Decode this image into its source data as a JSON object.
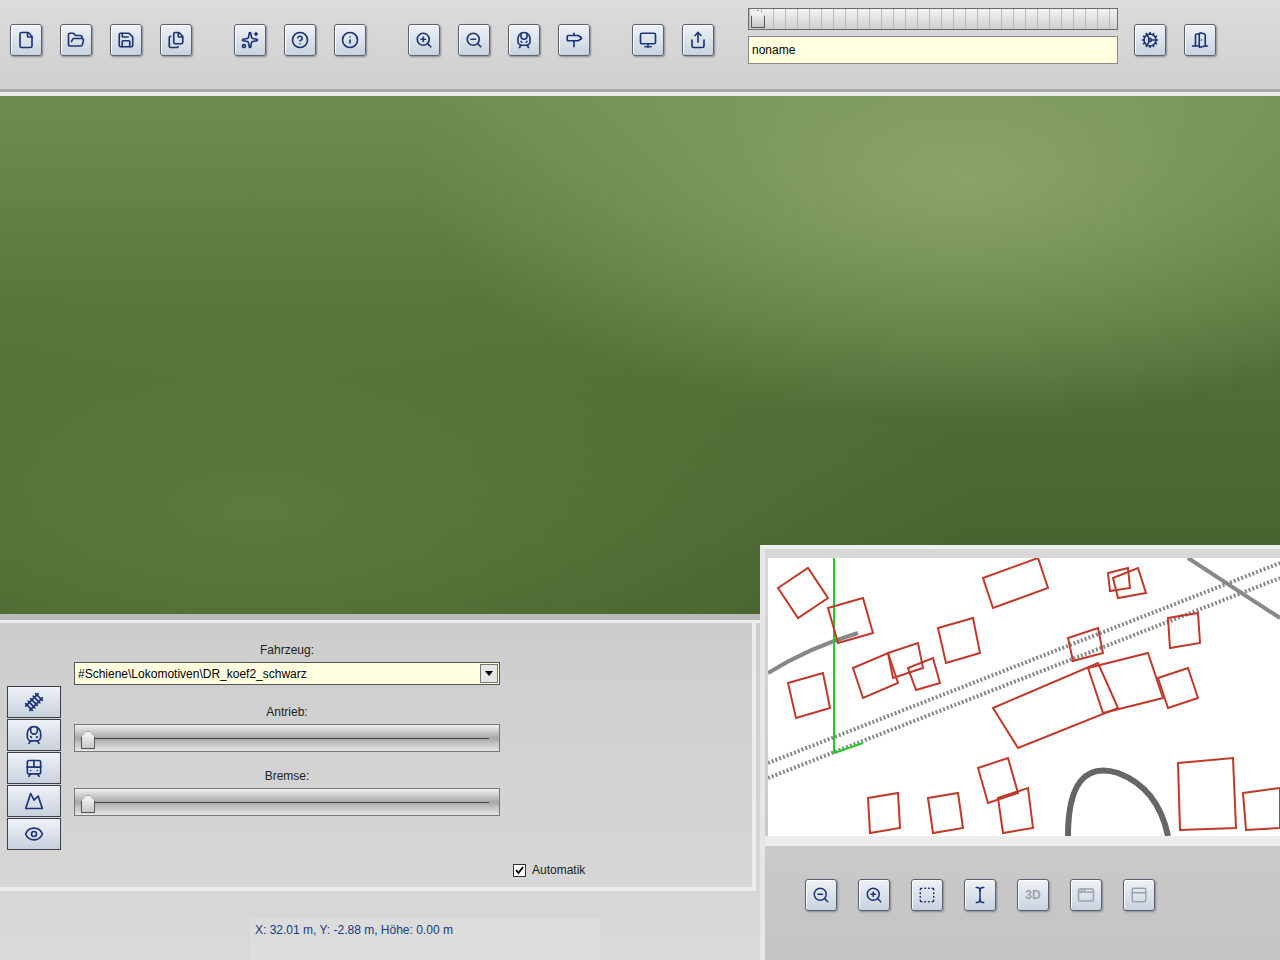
{
  "toolbar": {
    "groups": [
      [
        {
          "disabled": false
        },
        {
          "disabled": false
        },
        {
          "disabled": false
        },
        {
          "disabled": false
        }
      ],
      [
        {
          "disabled": false
        },
        {
          "disabled": false
        },
        {
          "disabled": false
        }
      ],
      [
        {
          "disabled": false
        },
        {
          "disabled": false
        },
        {
          "disabled": false
        },
        {
          "disabled": false
        }
      ],
      [
        {
          "disabled": false
        },
        {
          "disabled": false
        }
      ]
    ],
    "slider": {
      "level": 0.0
    },
    "file_name": "noname",
    "right_buttons": [
      {
        "disabled": false
      },
      {
        "disabled": false
      }
    ]
  },
  "vehicle_panel": {
    "label": "Fahrzeug:",
    "value": "#Schiene\\Lokomotiven\\DR_koef2_schwarz",
    "side_buttons": [
      {
        "selected": false
      },
      {
        "selected": false
      },
      {
        "selected": false
      },
      {
        "selected": false
      },
      {
        "selected": false
      }
    ],
    "sliders": [
      {
        "label": "Antrieb:",
        "level": 0.0
      },
      {
        "label": "Bremse:",
        "level": 0.0
      }
    ],
    "checkbox": {
      "label": "Automatik",
      "checked": true
    }
  },
  "map_panel": {
    "buttons": [
      {
        "label": "",
        "disabled": false
      },
      {
        "label": "",
        "disabled": false
      },
      {
        "label": "",
        "disabled": false
      },
      {
        "label": "",
        "disabled": false
      },
      {
        "label": "3D",
        "disabled": true
      },
      {
        "label": "",
        "disabled": true
      },
      {
        "label": "",
        "disabled": true
      }
    ]
  },
  "status_bar": {
    "text": "X: 32.01 m, Y: -2.88 m, Höhe: 0.00 m"
  }
}
